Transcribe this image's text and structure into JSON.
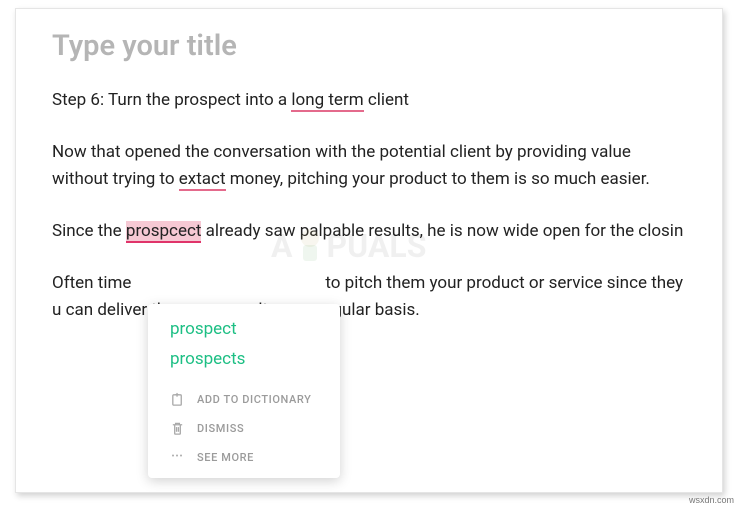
{
  "title_placeholder": "Type your title",
  "para1": {
    "before": "Step 6: Turn the prospect into a ",
    "err": "long term",
    "after": " client"
  },
  "para2": {
    "before": "Now that opened the conversation with the potential client by providing value without trying to ",
    "err": "extact",
    "after": " money, pitching your product to them is so much easier."
  },
  "para3": {
    "before": "Since the ",
    "err": "prospcect",
    "after": " already saw palpable results, he is now wide open for the closin"
  },
  "para4": "Often time                                              to pitch them your product or service since they                                            u can deliver the same results on a regular basis.",
  "popup": {
    "suggestions": [
      "prospect",
      "prospects"
    ],
    "actions": {
      "add": "ADD TO DICTIONARY",
      "dismiss": "DISMISS",
      "more": "SEE MORE"
    }
  },
  "watermark": {
    "left": "A",
    "right": "PUALS"
  },
  "attribution": "wsxdn.com"
}
